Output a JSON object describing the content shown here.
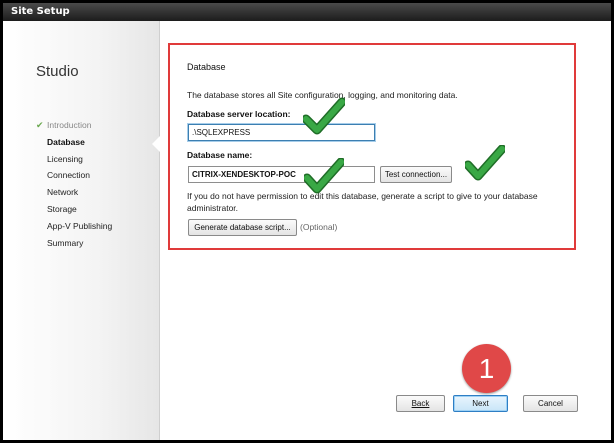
{
  "window": {
    "title": "Site Setup"
  },
  "sidebar": {
    "app_title": "Studio",
    "items": [
      {
        "label": "Introduction",
        "state": "completed"
      },
      {
        "label": "Database",
        "state": "active"
      },
      {
        "label": "Licensing",
        "state": "pending"
      },
      {
        "label": "Connection",
        "state": "pending"
      },
      {
        "label": "Network",
        "state": "pending"
      },
      {
        "label": "Storage",
        "state": "pending"
      },
      {
        "label": "App-V Publishing",
        "state": "pending"
      },
      {
        "label": "Summary",
        "state": "pending"
      }
    ]
  },
  "main": {
    "section_title": "Database",
    "description": "The database stores all Site configuration, logging, and monitoring data.",
    "server_location": {
      "label": "Database server location:",
      "value": ".\\SQLEXPRESS"
    },
    "database_name": {
      "label": "Database name:",
      "value": "CITRIX-XENDESKTOP-POC"
    },
    "test_connection_label": "Test connection...",
    "permission_help": "If you do not have permission to edit this database, generate a script to give to your database administrator.",
    "generate_script_label": "Generate database script...",
    "optional_label": "(Optional)"
  },
  "footer": {
    "back_label": "Back",
    "next_label": "Next",
    "cancel_label": "Cancel"
  },
  "annotations": {
    "step_badge": "1",
    "highlight_color": "#e03a3a",
    "checkmark_color": "#39a845",
    "badge_color": "#e04848",
    "checkmark_icon": "checkmark-icon"
  }
}
